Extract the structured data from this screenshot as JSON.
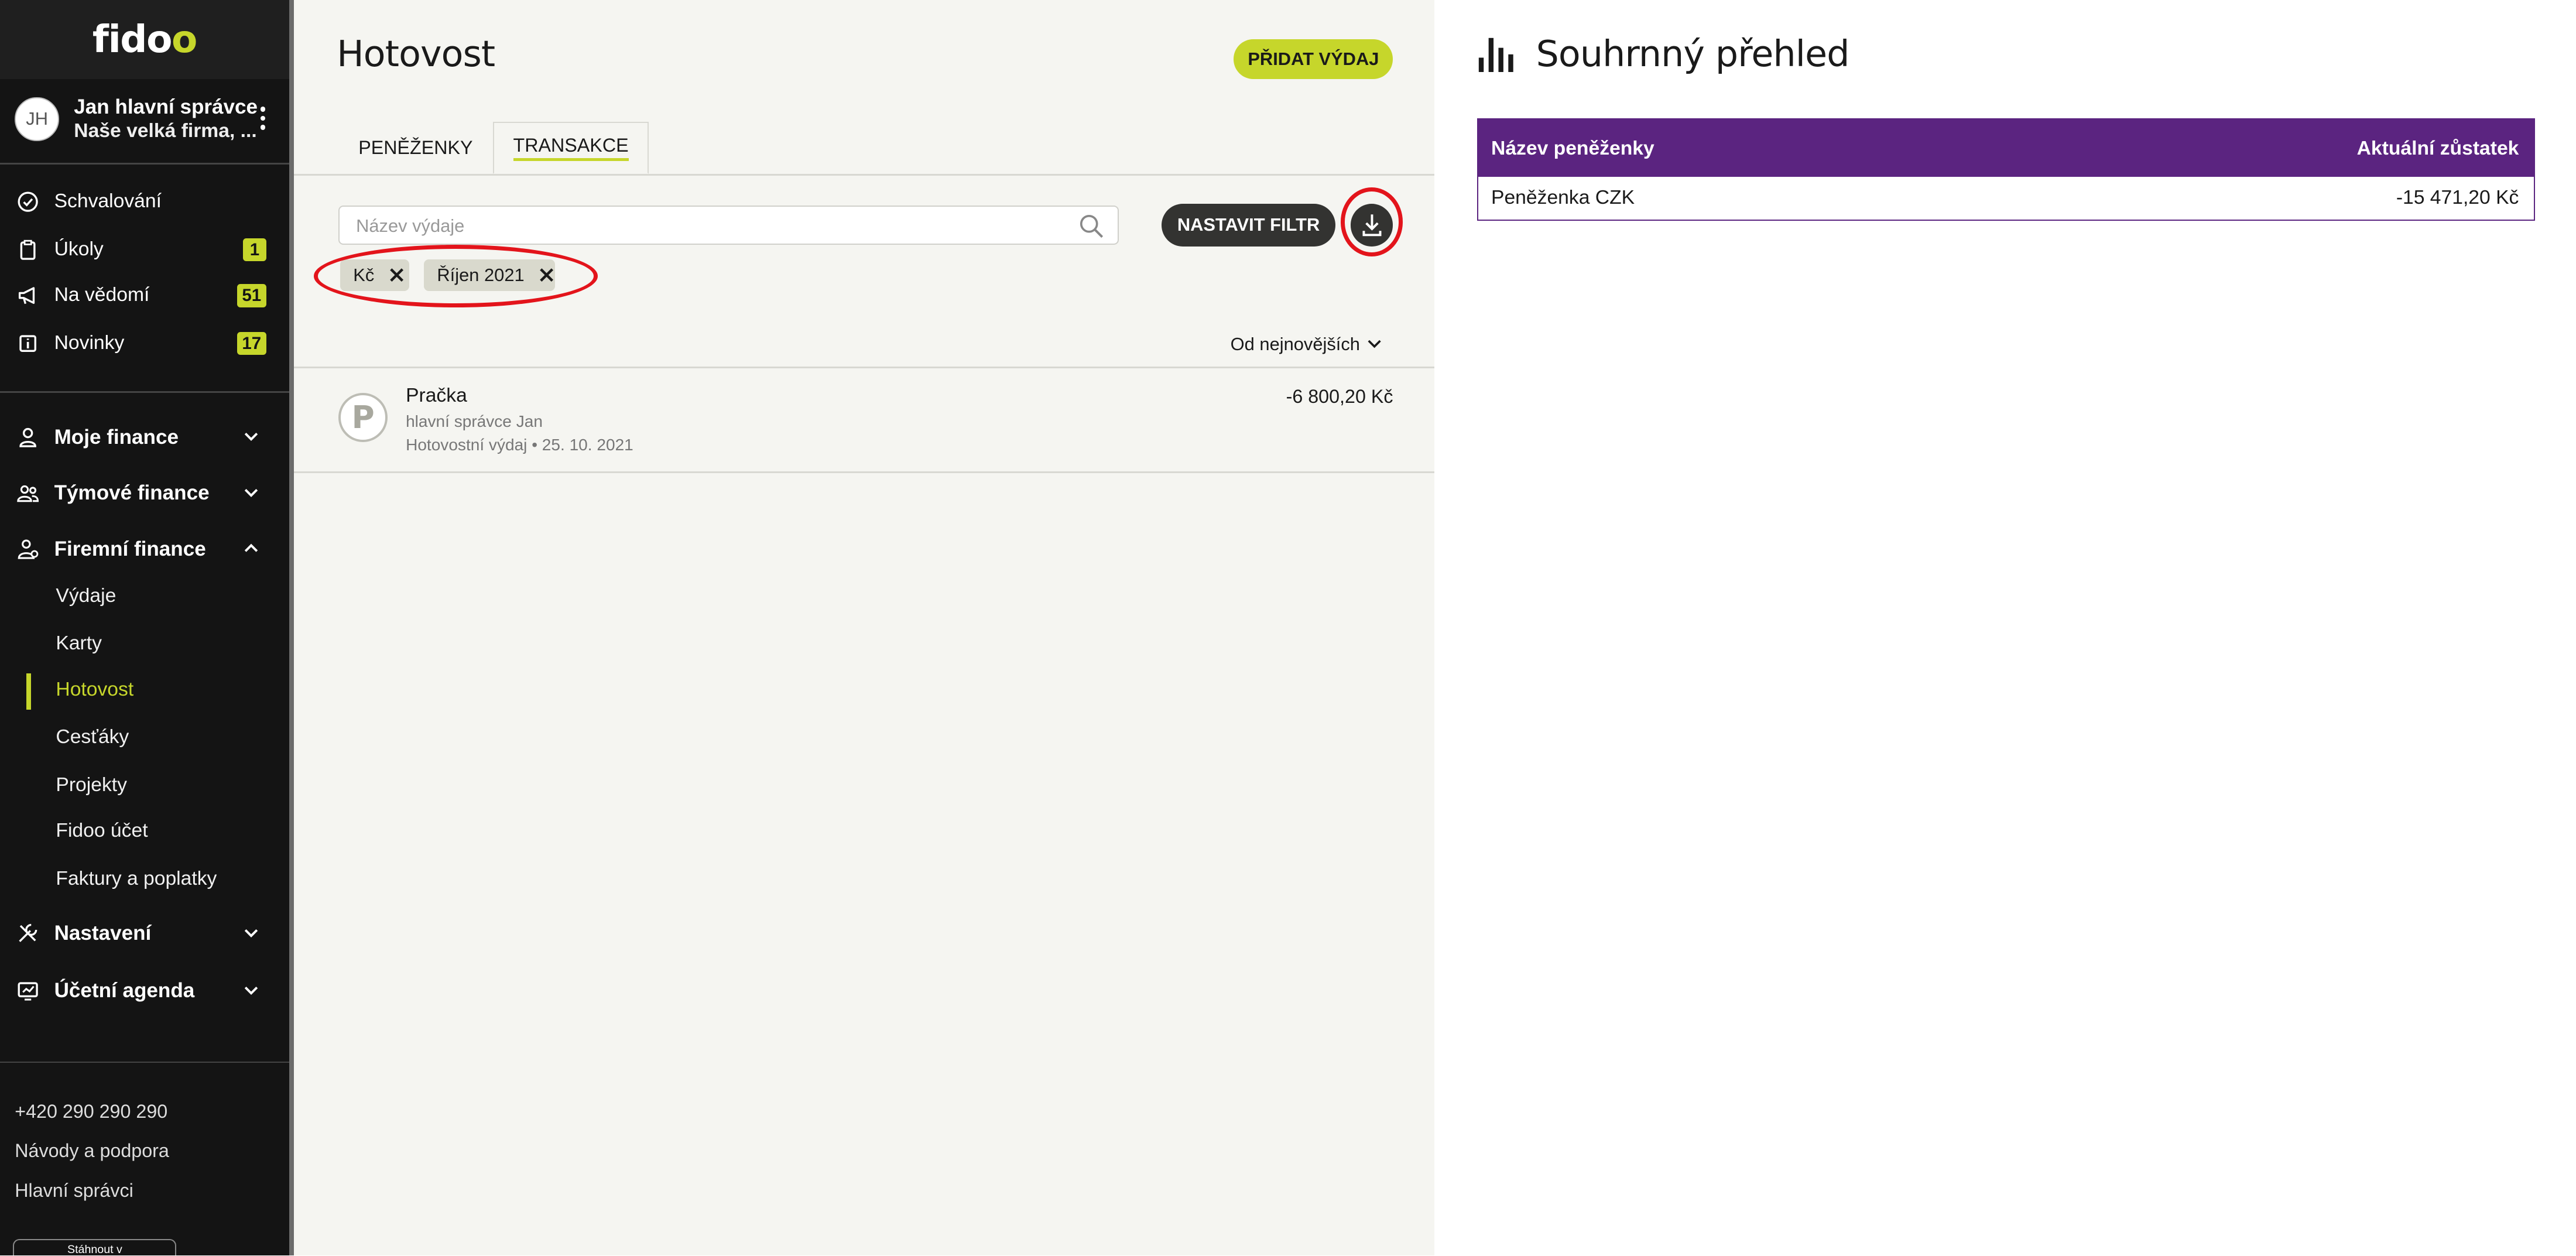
{
  "brand": {
    "logo_pre": "fid",
    "logo_o1": "o",
    "logo_o2": "o"
  },
  "user": {
    "initials": "JH",
    "name": "Jan hlavní správce",
    "firm": "Naše velká firma, ..."
  },
  "nav": {
    "top": [
      {
        "label": "Schvalování",
        "icon": "check-circle-icon"
      },
      {
        "label": "Úkoly",
        "icon": "clipboard-icon",
        "badge": "1"
      },
      {
        "label": "Na vědomí",
        "icon": "megaphone-icon",
        "badge": "51"
      },
      {
        "label": "Novinky",
        "icon": "info-icon",
        "badge": "17"
      }
    ],
    "sections": {
      "moje": "Moje finance",
      "tymove": "Týmové finance",
      "firemni": "Firemní finance",
      "nastaveni": "Nastavení",
      "ucetni": "Účetní agenda"
    },
    "firemni_items": [
      "Výdaje",
      "Karty",
      "Hotovost",
      "Cesťáky",
      "Projekty",
      "Fidoo účet",
      "Faktury a poplatky"
    ]
  },
  "footer": {
    "phone": "+420 290 290 290",
    "help": "Návody a podpora",
    "admins": "Hlavní správci",
    "app_button": "Stáhnout v"
  },
  "main": {
    "title": "Hotovost",
    "add_button": "PŘIDAT VÝDAJ",
    "tabs": [
      "PENĚŽENKY",
      "TRANSAKCE"
    ],
    "search_placeholder": "Název výdaje",
    "filter_button": "NASTAVIT FILTR",
    "chips": [
      "Kč",
      "Říjen 2021"
    ],
    "sort_label": "Od nejnovějších",
    "transactions": [
      {
        "initial": "P",
        "name": "Pračka",
        "user": "hlavní správce Jan",
        "meta": "Hotovostní výdaj • 25. 10. 2021",
        "amount": "-6 800,20 Kč"
      }
    ]
  },
  "summary": {
    "title": "Souhrnný přehled",
    "col_name": "Název peněženky",
    "col_balance": "Aktuální zůstatek",
    "rows": [
      {
        "name": "Peněženka CZK",
        "balance": "-15 471,20 Kč"
      }
    ]
  },
  "colors": {
    "accent": "#c6d62b",
    "purple": "#5b2480",
    "sidebar": "#141414",
    "annotation": "#e3141b"
  }
}
